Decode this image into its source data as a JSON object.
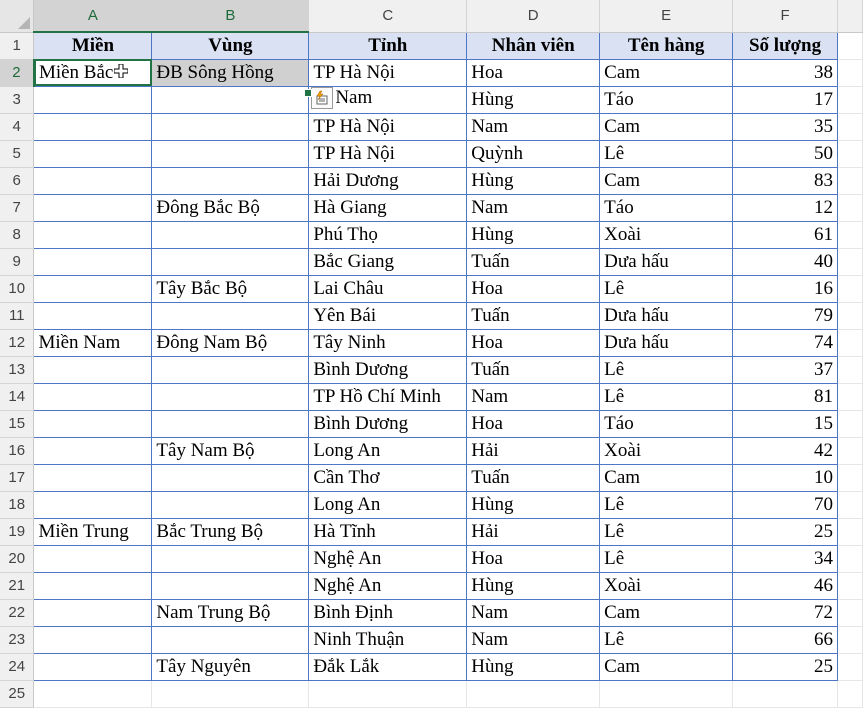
{
  "columns": [
    "A",
    "B",
    "C",
    "D",
    "E",
    "F"
  ],
  "rows": [
    "1",
    "2",
    "3",
    "4",
    "5",
    "6",
    "7",
    "8",
    "9",
    "10",
    "11",
    "12",
    "13",
    "14",
    "15",
    "16",
    "17",
    "18",
    "19",
    "20",
    "21",
    "22",
    "23",
    "24",
    "25"
  ],
  "headers": [
    "Miền",
    "Vùng",
    "Tỉnh",
    "Nhân viên",
    "Tên hàng",
    "Số lượng"
  ],
  "records": [
    [
      "Miền Bắc",
      "ĐB Sông Hồng",
      "TP Hà Nội",
      "Hoa",
      "Cam",
      "38"
    ],
    [
      "",
      "",
      "Nam",
      "Hùng",
      "Táo",
      "17"
    ],
    [
      "",
      "",
      "TP Hà Nội",
      "Nam",
      "Cam",
      "35"
    ],
    [
      "",
      "",
      "TP Hà Nội",
      "Quỳnh",
      "Lê",
      "50"
    ],
    [
      "",
      "",
      "Hải Dương",
      "Hùng",
      "Cam",
      "83"
    ],
    [
      "",
      "Đông Bắc Bộ",
      "Hà Giang",
      "Nam",
      "Táo",
      "12"
    ],
    [
      "",
      "",
      "Phú Thọ",
      "Hùng",
      "Xoài",
      "61"
    ],
    [
      "",
      "",
      "Bắc Giang",
      "Tuấn",
      "Dưa hấu",
      "40"
    ],
    [
      "",
      "Tây Bắc Bộ",
      "Lai Châu",
      "Hoa",
      "Lê",
      "16"
    ],
    [
      "",
      "",
      "Yên Bái",
      "Tuấn",
      "Dưa hấu",
      "79"
    ],
    [
      "Miền Nam",
      "Đông Nam Bộ",
      "Tây Ninh",
      "Hoa",
      "Dưa hấu",
      "74"
    ],
    [
      "",
      "",
      "Bình Dương",
      "Tuấn",
      "Lê",
      "37"
    ],
    [
      "",
      "",
      "TP Hồ Chí Minh",
      "Nam",
      "Lê",
      "81"
    ],
    [
      "",
      "",
      "Bình Dương",
      "Hoa",
      "Táo",
      "15"
    ],
    [
      "",
      "Tây Nam Bộ",
      "Long An",
      "Hải",
      "Xoài",
      "42"
    ],
    [
      "",
      "",
      "Cần Thơ",
      "Tuấn",
      "Cam",
      "10"
    ],
    [
      "",
      "",
      "Long An",
      "Hùng",
      "Lê",
      "70"
    ],
    [
      "Miền Trung",
      "Bắc Trung Bộ",
      "Hà Tĩnh",
      "Hải",
      "Lê",
      "25"
    ],
    [
      "",
      "",
      "Nghệ An",
      "Hoa",
      "Lê",
      "34"
    ],
    [
      "",
      "",
      "Nghệ An",
      "Hùng",
      "Xoài",
      "46"
    ],
    [
      "",
      "Nam Trung Bộ",
      "Bình Định",
      "Nam",
      "Cam",
      "72"
    ],
    [
      "",
      "",
      "Ninh Thuận",
      "Nam",
      "Lê",
      "66"
    ],
    [
      "",
      "Tây Nguyên",
      "Đắk Lắk",
      "Hùng",
      "Cam",
      "25"
    ]
  ],
  "selection": {
    "active": "A2",
    "range": "A2:B2"
  },
  "icons": {
    "flash_fill": "flash-fill-options-icon",
    "cursor": "cell-cursor-icon",
    "corner": "select-all-icon"
  },
  "colors": {
    "accent": "#217346",
    "header_fill": "#d9e1f2",
    "border": "#4f76c4",
    "selection_fill": "#d0d0d0"
  }
}
